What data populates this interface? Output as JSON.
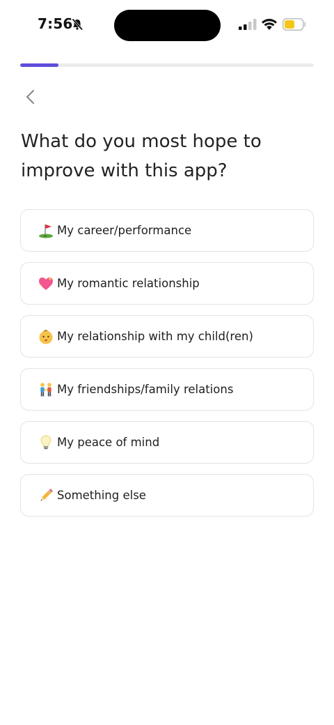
{
  "status_bar": {
    "time": "7:56"
  },
  "progress": {
    "fraction": 0.13,
    "color": "#5c4ddb"
  },
  "question": {
    "title": "What do you most hope to improve with this app?"
  },
  "options": [
    {
      "icon": "golf-flag-icon",
      "label": "My career/performance"
    },
    {
      "icon": "sparkling-heart-icon",
      "label": "My romantic relationship"
    },
    {
      "icon": "baby-face-icon",
      "label": "My relationship with my child(ren)"
    },
    {
      "icon": "people-holding-hands-icon",
      "label": "My friendships/family relations"
    },
    {
      "icon": "light-bulb-icon",
      "label": "My peace of mind"
    },
    {
      "icon": "pencil-icon",
      "label": "Something else"
    }
  ],
  "colors": {
    "accent": "#5c4ddb",
    "battery": "#f5c518",
    "border": "#e3e3e6"
  }
}
